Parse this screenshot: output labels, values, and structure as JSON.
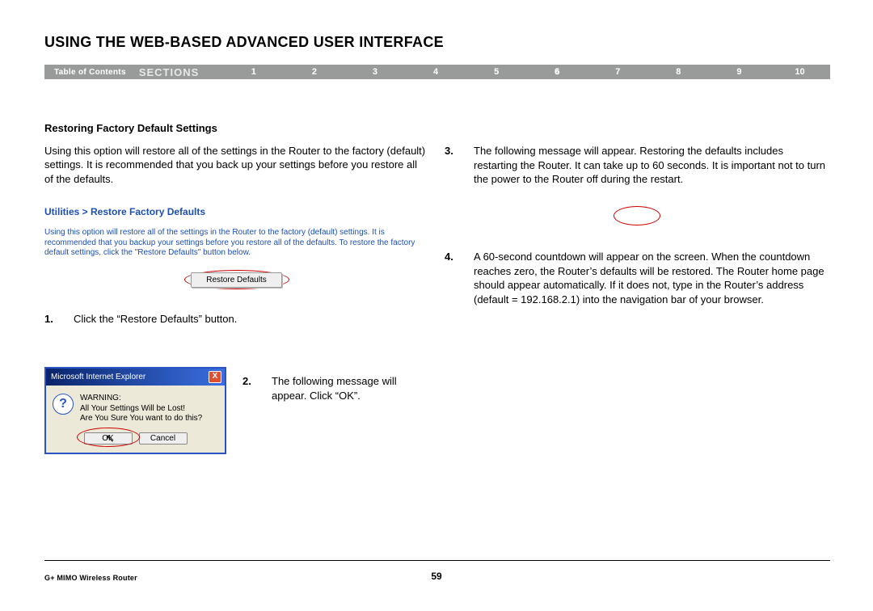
{
  "header": {
    "title": "USING THE WEB-BASED ADVANCED USER INTERFACE"
  },
  "nav": {
    "toc": "Table of Contents",
    "sections_label": "SECTIONS",
    "items": [
      "1",
      "2",
      "3",
      "4",
      "5",
      "6",
      "7",
      "8",
      "9",
      "10"
    ],
    "active_index": 5
  },
  "left": {
    "sub_heading": "Restoring Factory Default Settings",
    "intro": "Using this option will restore all of the settings in the Router to the factory (default) settings. It is recommended that you back up your settings before you restore all of the defaults.",
    "breadcrumb": "Utilities > Restore Factory Defaults",
    "blue_desc": "Using this option will restore all of the settings in the Router to the factory (default) settings. It is recommended that you backup your settings before you restore all of the defaults. To restore the factory default settings, click the \"Restore Defaults\" button below.",
    "restore_button": "Restore Defaults",
    "step1_num": "1.",
    "step1_text": "Click the “Restore Defaults” button.",
    "step2_num": "2.",
    "step2_text": "The following message will appear. Click “OK”."
  },
  "dialog": {
    "title": "Microsoft Internet Explorer",
    "close": "X",
    "icon": "?",
    "line1": "WARNING:",
    "line2": "All Your Settings Will be Lost!",
    "line3": "Are You Sure You want to do this?",
    "ok": "OK",
    "cancel": "Cancel"
  },
  "right": {
    "step3_num": "3.",
    "step3_text": "The following message will appear. Restoring the defaults includes restarting the Router. It can take up to 60 seconds. It is important not to turn the power to the Router off during the restart.",
    "step4_num": "4.",
    "step4_text": "A 60-second countdown will appear on the screen. When the countdown reaches zero, the Router’s defaults will be restored. The Router home page should appear automatically. If it does not, type in the Router’s address (default = 192.168.2.1) into the navigation bar of your browser."
  },
  "footer": {
    "product": "G+ MIMO Wireless Router",
    "page": "59"
  }
}
